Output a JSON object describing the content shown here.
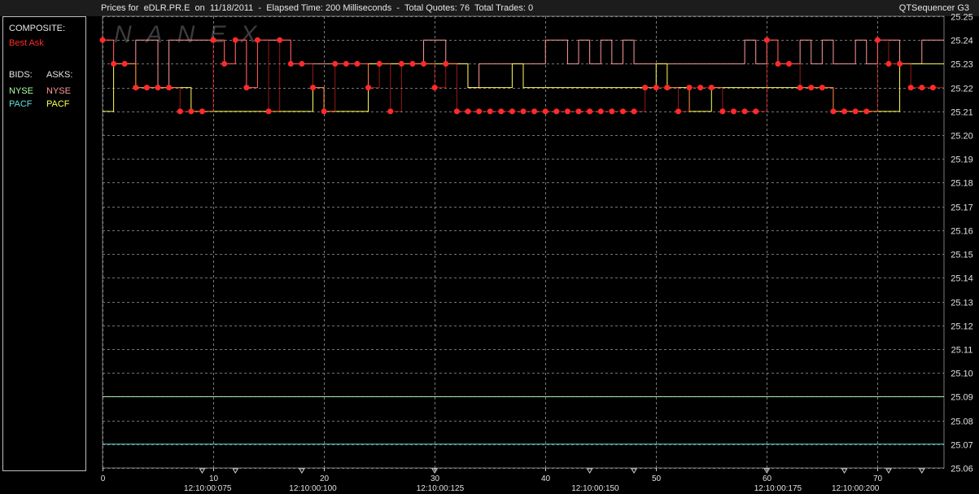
{
  "header": {
    "title": "Prices for  eDLR.PR.E  on  11/18/2011  -  Elapsed Time: 200 Milliseconds  -  Total Quotes: 76  Total Trades: 0",
    "app_name": "QTSequencer G3",
    "watermark": "NANEX"
  },
  "legend": {
    "composite_label": "COMPOSITE:",
    "composite_item": "Best Ask",
    "bids_label": "BIDS:",
    "asks_label": "ASKS:",
    "bids": [
      "NYSE",
      "PACF"
    ],
    "asks": [
      "NYSE",
      "PACF"
    ]
  },
  "colors": {
    "background": "#000000",
    "grid": "#9a9a9a",
    "best_ask": "#ff2a2a",
    "nyse_bid": "#a8ffa8",
    "pacf_bid": "#5fe0e0",
    "nyse_ask": "#ff9a9a",
    "pacf_ask": "#ffff55"
  },
  "chart_data": {
    "type": "line",
    "x_ticks": [
      0,
      10,
      20,
      30,
      40,
      50,
      60,
      70
    ],
    "time_labels": [
      {
        "x": 9.5,
        "label": "12:10:00:075"
      },
      {
        "x": 19,
        "label": "12:10:00:100"
      },
      {
        "x": 30.5,
        "label": "12:10:00:125"
      },
      {
        "x": 44.5,
        "label": "12:10:00:150"
      },
      {
        "x": 61,
        "label": "12:10:00:175"
      },
      {
        "x": 68,
        "label": "12:10:00:200"
      }
    ],
    "time_markers": [
      9,
      12,
      18,
      30,
      44,
      48,
      60,
      67,
      71,
      74
    ],
    "xlim": [
      0,
      76
    ],
    "ylim": [
      25.06,
      25.25
    ],
    "y_ticks": [
      25.25,
      25.24,
      25.23,
      25.22,
      25.21,
      25.2,
      25.19,
      25.18,
      25.17,
      25.16,
      25.15,
      25.14,
      25.13,
      25.12,
      25.11,
      25.1,
      25.09,
      25.08,
      25.07,
      25.06
    ],
    "grid": true,
    "series": [
      {
        "name": "Best Ask",
        "values": [
          25.24,
          25.23,
          25.23,
          25.22,
          25.22,
          25.22,
          25.22,
          25.21,
          25.21,
          25.21,
          25.24,
          25.23,
          25.24,
          25.22,
          25.24,
          25.21,
          25.24,
          25.23,
          25.23,
          25.22,
          25.21,
          25.23,
          25.23,
          25.23,
          25.22,
          25.23,
          25.21,
          25.23,
          25.23,
          25.23,
          25.22,
          25.23,
          25.21,
          25.21,
          25.21,
          25.21,
          25.21,
          25.21,
          25.21,
          25.21,
          25.21,
          25.21,
          25.21,
          25.21,
          25.21,
          25.21,
          25.21,
          25.21,
          25.21,
          25.22,
          25.22,
          25.22,
          25.21,
          25.22,
          25.22,
          25.22,
          25.21,
          25.21,
          25.21,
          25.21,
          25.24,
          25.23,
          25.23,
          25.22,
          25.22,
          25.22,
          25.21,
          25.21,
          25.21,
          25.21,
          25.24,
          25.23,
          25.23,
          25.22,
          25.22,
          25.22
        ]
      },
      {
        "name": "NYSE",
        "side": "bid",
        "values": [
          25.09,
          25.09,
          25.09,
          25.09,
          25.09,
          25.09,
          25.09,
          25.09,
          25.09,
          25.09,
          25.09,
          25.09,
          25.09,
          25.09,
          25.09,
          25.09,
          25.09,
          25.09,
          25.09,
          25.09,
          25.09,
          25.09,
          25.09,
          25.09,
          25.09,
          25.09,
          25.09,
          25.09,
          25.09,
          25.09,
          25.09,
          25.09,
          25.09,
          25.09,
          25.09,
          25.09,
          25.09,
          25.09,
          25.09,
          25.09,
          25.09,
          25.09,
          25.09,
          25.09,
          25.09,
          25.09,
          25.09,
          25.09,
          25.09,
          25.09,
          25.09,
          25.09,
          25.09,
          25.09,
          25.09,
          25.09,
          25.09,
          25.09,
          25.09,
          25.09,
          25.09,
          25.09,
          25.09,
          25.09,
          25.09,
          25.09,
          25.09,
          25.09,
          25.09,
          25.09,
          25.09,
          25.09,
          25.09,
          25.09,
          25.09,
          25.09
        ]
      },
      {
        "name": "PACF",
        "side": "bid",
        "values": [
          25.07,
          25.07,
          25.07,
          25.07,
          25.07,
          25.07,
          25.07,
          25.07,
          25.07,
          25.07,
          25.07,
          25.07,
          25.07,
          25.07,
          25.07,
          25.07,
          25.07,
          25.07,
          25.07,
          25.07,
          25.07,
          25.07,
          25.07,
          25.07,
          25.07,
          25.07,
          25.07,
          25.07,
          25.07,
          25.07,
          25.07,
          25.07,
          25.07,
          25.07,
          25.07,
          25.07,
          25.07,
          25.07,
          25.07,
          25.07,
          25.07,
          25.07,
          25.07,
          25.07,
          25.07,
          25.07,
          25.07,
          25.07,
          25.07,
          25.07,
          25.07,
          25.07,
          25.07,
          25.07,
          25.07,
          25.07,
          25.07,
          25.07,
          25.07,
          25.07,
          25.07,
          25.07,
          25.07,
          25.07,
          25.07,
          25.07,
          25.07,
          25.07,
          25.07,
          25.07,
          25.07,
          25.07,
          25.07,
          25.07,
          25.07,
          25.07
        ]
      },
      {
        "name": "NYSE",
        "side": "ask",
        "values": [
          25.24,
          25.23,
          25.23,
          25.24,
          25.24,
          25.22,
          25.24,
          25.24,
          25.24,
          25.24,
          25.24,
          25.23,
          25.24,
          25.22,
          25.24,
          25.24,
          25.24,
          25.23,
          25.23,
          25.23,
          25.23,
          25.23,
          25.23,
          25.23,
          25.23,
          25.23,
          25.23,
          25.23,
          25.23,
          25.24,
          25.24,
          25.23,
          25.23,
          25.22,
          25.23,
          25.23,
          25.23,
          25.23,
          25.23,
          25.23,
          25.24,
          25.24,
          25.23,
          25.24,
          25.23,
          25.24,
          25.23,
          25.24,
          25.23,
          25.23,
          25.23,
          25.23,
          25.23,
          25.23,
          25.23,
          25.23,
          25.23,
          25.23,
          25.24,
          25.23,
          25.24,
          25.23,
          25.23,
          25.24,
          25.23,
          25.24,
          25.23,
          25.23,
          25.24,
          25.23,
          25.24,
          25.24,
          25.23,
          25.23,
          25.24,
          25.24
        ]
      },
      {
        "name": "PACF",
        "side": "ask",
        "values": [
          25.21,
          25.23,
          25.23,
          25.22,
          25.22,
          25.22,
          25.22,
          25.22,
          25.21,
          25.21,
          25.21,
          25.21,
          25.21,
          25.21,
          25.21,
          25.21,
          25.21,
          25.21,
          25.21,
          25.22,
          25.21,
          25.21,
          25.21,
          25.21,
          25.23,
          25.23,
          25.23,
          25.23,
          25.23,
          25.23,
          25.23,
          25.23,
          25.23,
          25.22,
          25.22,
          25.22,
          25.22,
          25.23,
          25.22,
          25.22,
          25.22,
          25.22,
          25.22,
          25.22,
          25.22,
          25.22,
          25.22,
          25.22,
          25.22,
          25.22,
          25.23,
          25.22,
          25.22,
          25.21,
          25.21,
          25.22,
          25.22,
          25.22,
          25.22,
          25.22,
          25.22,
          25.22,
          25.22,
          25.22,
          25.22,
          25.22,
          25.21,
          25.21,
          25.21,
          25.21,
          25.21,
          25.21,
          25.23,
          25.23,
          25.23,
          25.23
        ]
      }
    ]
  }
}
